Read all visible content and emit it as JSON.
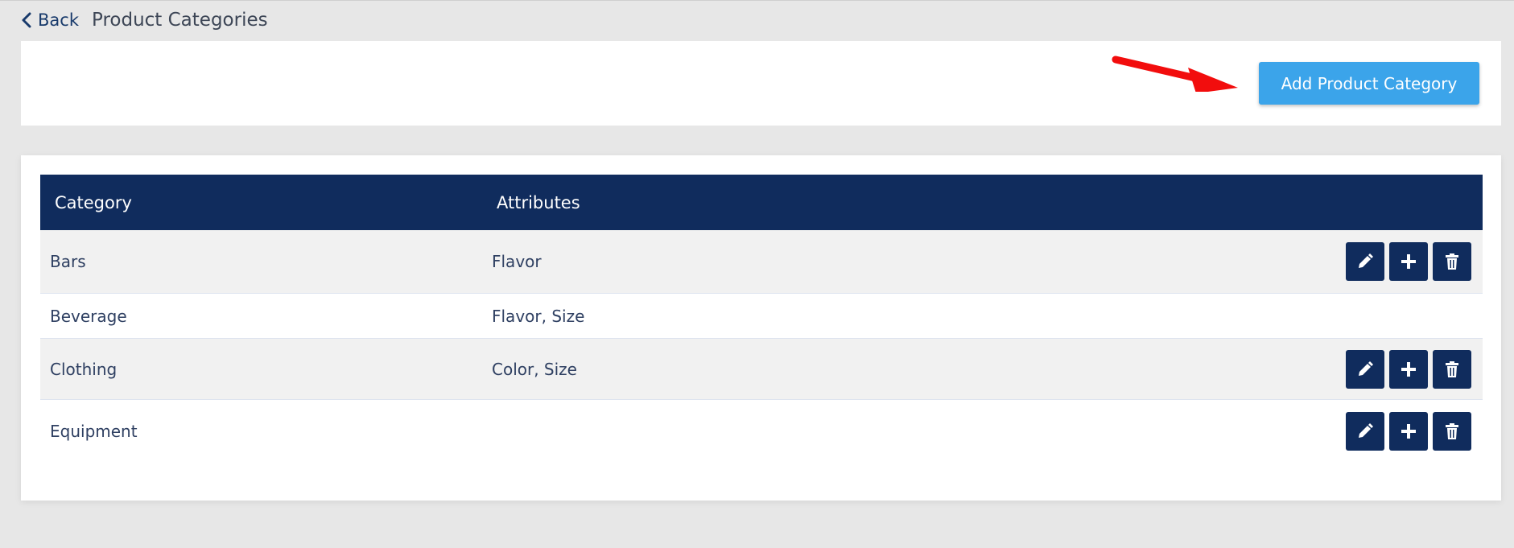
{
  "header": {
    "back_label": "Back",
    "title": "Product Categories"
  },
  "toolbar": {
    "add_label": "Add Product Category"
  },
  "table": {
    "columns": [
      "Category",
      "Attributes"
    ],
    "rows": [
      {
        "category": "Bars",
        "attributes": "Flavor",
        "has_actions": true
      },
      {
        "category": "Beverage",
        "attributes": "Flavor, Size",
        "has_actions": false
      },
      {
        "category": "Clothing",
        "attributes": "Color, Size",
        "has_actions": true
      },
      {
        "category": "Equipment",
        "attributes": "",
        "has_actions": true
      }
    ]
  },
  "icons": {
    "back": "chevron-left-icon",
    "edit": "pencil-icon",
    "add": "plus-icon",
    "delete": "trash-icon",
    "annotation": "red-arrow-icon"
  },
  "colors": {
    "primary_navy": "#102c5d",
    "add_button": "#3ba4ea",
    "annotation_red": "#f20d0d",
    "page_bg": "#e7e7e7"
  }
}
